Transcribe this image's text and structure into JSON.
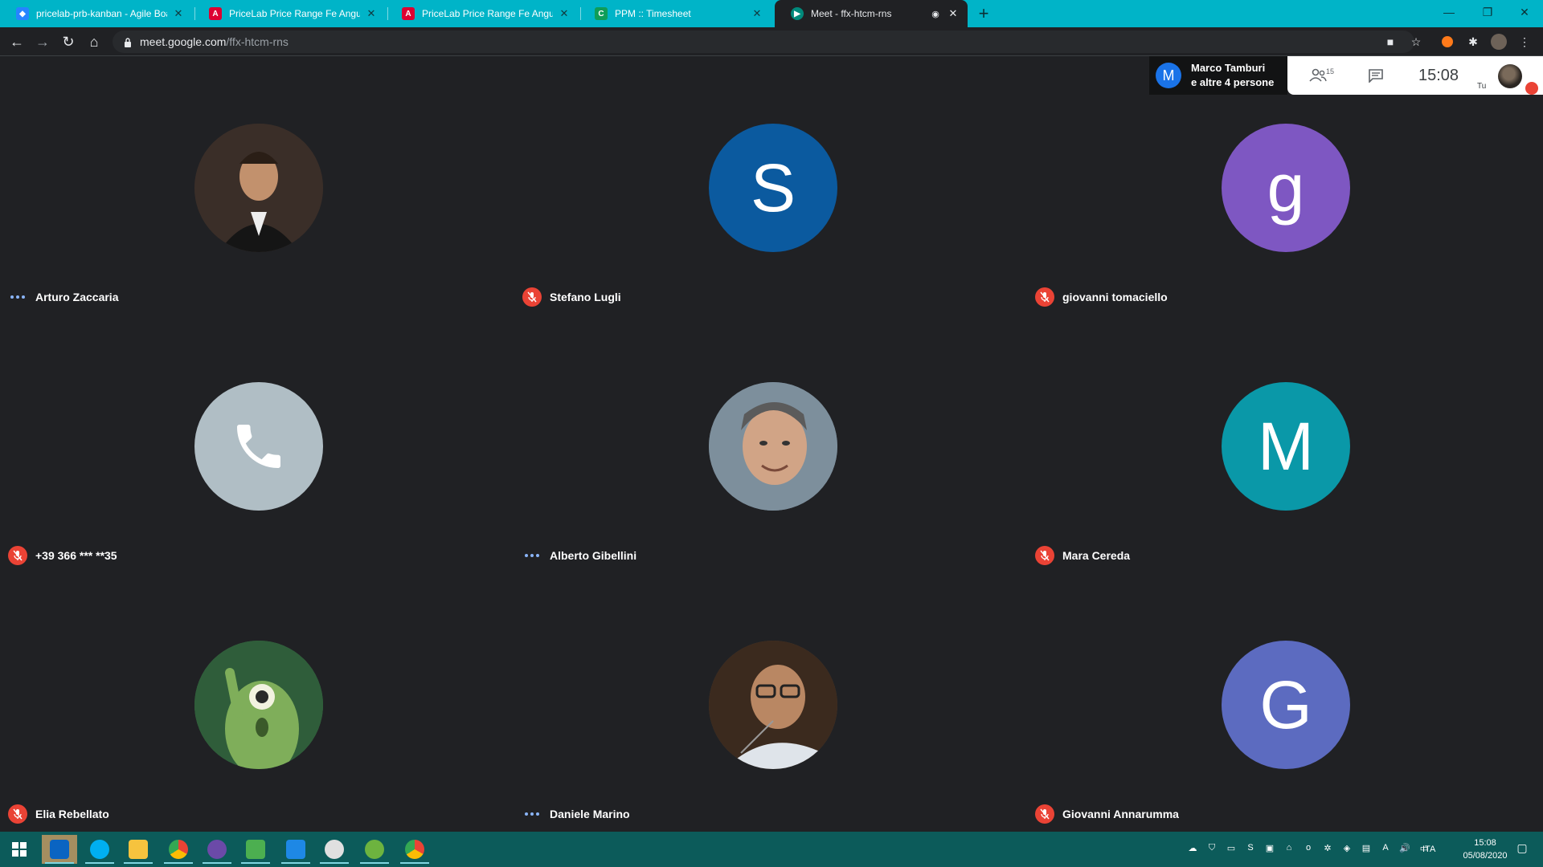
{
  "browser": {
    "tabs": [
      {
        "title": "pricelab-prb-kanban - Agile Boar",
        "favicon": "jira-icon",
        "color": "#2684ff"
      },
      {
        "title": "PriceLab Price Range Fe Angular",
        "favicon": "angular-icon",
        "color": "#dd0031"
      },
      {
        "title": "PriceLab Price Range Fe Angular",
        "favicon": "angular-icon",
        "color": "#dd0031"
      },
      {
        "title": "PPM :: Timesheet",
        "favicon": "timesheet-icon",
        "color": "#0f9d58"
      },
      {
        "title": "Meet - ffx-htcm-rns",
        "favicon": "meet-icon",
        "color": "#00897b"
      }
    ],
    "url_host": "meet.google.com",
    "url_path": "/ffx-htcm-rns"
  },
  "meeting": {
    "presenter_initial": "M",
    "presenter_line1": "Marco Tamburi",
    "presenter_line2": "e altre 4 persone",
    "participant_count": "15",
    "time": "15:08",
    "self_label": "Tu"
  },
  "participants": [
    {
      "name": "Arturo Zaccaria",
      "muted": false,
      "avatar": "photo",
      "bg": "#3a2e28"
    },
    {
      "name": "Stefano Lugli",
      "muted": true,
      "avatar": "letter",
      "letter": "S",
      "bg": "#0b5a9f"
    },
    {
      "name": "giovanni tomaciello",
      "muted": true,
      "avatar": "letter",
      "letter": "g",
      "bg": "#7e57c2"
    },
    {
      "name": "+39 366 *** **35",
      "muted": true,
      "avatar": "phone",
      "bg": "#b0bec5"
    },
    {
      "name": "Alberto Gibellini",
      "muted": false,
      "avatar": "photo",
      "bg": "#6b7d8c"
    },
    {
      "name": "Mara Cereda",
      "muted": true,
      "avatar": "letter",
      "letter": "M",
      "bg": "#0a98a8"
    },
    {
      "name": "Elia Rebellato",
      "muted": true,
      "avatar": "photo",
      "bg": "#3e7a4a"
    },
    {
      "name": "Daniele Marino",
      "muted": false,
      "avatar": "photo",
      "bg": "#5b4636"
    },
    {
      "name": "Giovanni Annarumma",
      "muted": true,
      "avatar": "letter",
      "letter": "G",
      "bg": "#5c6bc0"
    }
  ],
  "taskbar": {
    "apps": [
      "outlook-icon",
      "skype-icon",
      "file-explorer-icon",
      "chrome-icon",
      "teams-like-icon",
      "notepad-icon",
      "vscode-icon",
      "gitkraken-icon",
      "spring-icon",
      "chrome-icon"
    ],
    "language": "ITA",
    "clock_time": "15:08",
    "clock_date": "05/08/2020"
  }
}
